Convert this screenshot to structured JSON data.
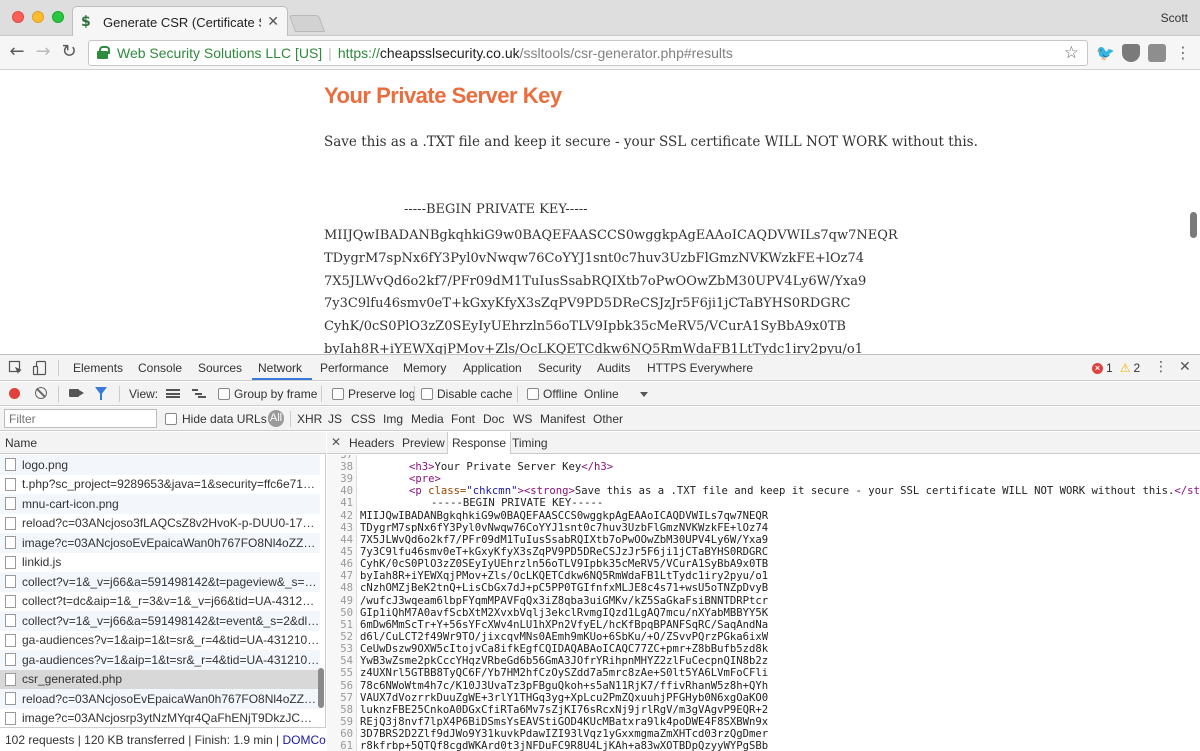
{
  "browser": {
    "tab_title": "Generate CSR (Certificate Sign",
    "profile": "Scott",
    "ev_name": "Web Security Solutions LLC [US]",
    "url_scheme": "https://",
    "url_host": "cheapsslsecurity.co.uk",
    "url_path": "/ssltools/csr-generator.php#results"
  },
  "page": {
    "heading": "Your Private Server Key",
    "intro": "Save this as a .TXT file and keep it secure - your SSL certificate WILL NOT WORK without this.",
    "key_begin": "-----BEGIN PRIVATE KEY-----",
    "key_lines": [
      "MIIJQwIBADANBgkqhkiG9w0BAQEFAASCCS0wggkpAgEAAoICAQDVWILs7qw7NEQR",
      "TDygrM7spNx6fY3Pyl0vNwqw76CoYYJ1snt0c7huv3UzbFlGmzNVKWzkFE+lOz74",
      "7X5JLWvQd6o2kf7/PFr09dM1TuIusSsabRQIXtb7oPwOOwZbM30UPV4Ly6W/Yxa9",
      "7y3C9lfu46smv0eT+kGxyKfyX3sZqPV9PD5DReCSJzJr5F6ji1jCTaBYHS0RDGRC",
      "CyhK/0cS0PlO3zZ0SEyIyUEhrzln56oTLV9Ipbk35cMeRV5/VCurA1SyBbA9x0TB",
      "byIah8R+iYEWXqjPMov+Zls/OcLKQETCdkw6NQ5RmWdaFB1LtTydc1iry2pyu/o1"
    ]
  },
  "devtools": {
    "tabs": [
      "Elements",
      "Console",
      "Sources",
      "Network",
      "Performance",
      "Memory",
      "Application",
      "Security",
      "Audits",
      "HTTPS Everywhere"
    ],
    "errors": "1",
    "warnings": "2",
    "net_toolbar": {
      "view_label": "View:",
      "group_by_frame": "Group by frame",
      "preserve_log": "Preserve log",
      "disable_cache": "Disable cache",
      "offline": "Offline",
      "throttle": "Online"
    },
    "filter": {
      "placeholder": "Filter",
      "hide_data_urls": "Hide data URLs",
      "all": "All",
      "types": [
        "XHR",
        "JS",
        "CSS",
        "Img",
        "Media",
        "Font",
        "Doc",
        "WS",
        "Manifest",
        "Other"
      ]
    },
    "names_header": "Name",
    "requests": [
      "logo.png",
      "t.php?sc_project=9289653&java=1&security=ffc6e71e&...",
      "mnu-cart-icon.png",
      "reload?c=03ANcjoso3fLAQCsZ8v2HvoK-p-DUU0-175uk...",
      "image?c=03ANcjosoEvEpaicaWan0h767FO8Nl4oZZmiO...",
      "linkid.js",
      "collect?v=1&_v=j66&a=591498142&t=pageview&_s=1&dl...",
      "collect?t=dc&aip=1&_r=3&v=1&_v=j66&tid=UA-43121050...",
      "collect?v=1&_v=j66&a=591498142&t=event&_s=2&dl=htt...",
      "ga-audiences?v=1&aip=1&t=sr&_r=4&tid=UA-43121050-...",
      "ga-audiences?v=1&aip=1&t=sr&_r=4&tid=UA-43121050-...",
      "csr_generated.php",
      "reload?c=03ANcjosoEvEpaicaWan0h767FO8Nl4oZZmiO...",
      "image?c=03ANcjosrp3ytNzMYqr4QaFhENjT9DkzJCwP40..."
    ],
    "status": {
      "text": "102 requests | 120 KB transferred | Finish: 1.9 min | ",
      "link": "DOMCon..."
    },
    "detail_tabs": [
      "Headers",
      "Preview",
      "Response",
      "Timing"
    ],
    "response": {
      "line_38_tag_open": "<h3>",
      "line_38_text": "Your Private Server Key",
      "line_38_tag_close": "</h3>",
      "line_39": "<pre>",
      "line_40_p": "<p ",
      "line_40_attr": "class=",
      "line_40_val": "\"chkcmn\"",
      "line_40_strong": "><strong>",
      "line_40_text": "Save this as a .TXT file and keep it secure - your SSL certificate WILL NOT WORK without this.",
      "line_40_end": "</stron",
      "line_41": "-----BEGIN PRIVATE KEY-----",
      "key_lines": [
        "MIIJQwIBADANBgkqhkiG9w0BAQEFAASCCS0wggkpAgEAAoICAQDVWILs7qw7NEQR",
        "TDygrM7spNx6fY3Pyl0vNwqw76CoYYJ1snt0c7huv3UzbFlGmzNVKWzkFE+lOz74",
        "7X5JLWvQd6o2kf7/PFr09dM1TuIusSsabRQIXtb7oPwOOwZbM30UPV4Ly6W/Yxa9",
        "7y3C9lfu46smv0eT+kGxyKfyX3sZqPV9PD5DReCSJzJr5F6ji1jCTaBYHS0RDGRC",
        "CyhK/0cS0PlO3zZ0SEyIyUEhrzln56oTLV9Ipbk35cMeRV5/VCurA1SyBbA9x0TB",
        "byIah8R+iYEWXqjPMov+Zls/OcLKQETCdkw6NQ5RmWdaFB1LtTydc1iry2pyu/o1",
        "cNzhOMZjBeK2tnQ+LisCbGx7dJ+pC5PP0TGIfnfxMLJE8c4s71+wsU5oTNZpDvyB",
        "/wufcJ3wqeam6lbpFYqmMPAVFqQx3iZ8qba3uiGMKv/kZ5SaGkaFsiBNNTDRPtcr",
        "GIp1iQhM7A0avfScbXtM2XvxbVqlj3ekclRvmgIQzd1LgAQ7mcu/nXYabMBBYY5K",
        "6mDw6MmScTr+Y+56sYFcXWv4nLU1hXPn2VfyEL/hcKfBpqBPANFSqRC/SaqAndNa",
        "d6l/CuLCT2f49Wr9TO/jixcqvMNs0AEmh9mKUo+6SbKu/+O/ZSvvPQrzPGka6ixW",
        "CeUwDszw9OXW5cItojvCa8ifkEgfCQIDAQABAoICAQC77ZC+pmr+Z8bBufb5zd8k",
        "YwB3wZsme2pkCccYHqzVRbeGd6b56GmA3JOfrYRihpnMHYZ2zlFuCecpnQIN8b2z",
        "z4UXNrl5GTBB8TyQC6F/Yb7HM2hfCzOySZdd7a5mrc8zAe+S0lt5YA6LVmFoCFli",
        "78c6NWoWtm4h7c/K10J3UvaTz3pFBguQkoh+s5aN11RjK7/ffivRhanW5z8h+QYh",
        "VAUX7dVozrrkDuuZgWE+3rlY1THGq3yg+XpLcu2PmZQxuuhjPFGHyb0N6xgOaKO0",
        "luknzFBE25CnkoA0DGxCfiRTa6Mv7sZjKI76sRcxNj9jrlRgV/m3gVAgvP9EQR+2",
        "REjQ3j8nvf7lpX4P6BiDSmsYsEAVStiGOD4KUcMBatxra9lk4poDWE4F8SXBWn9x",
        "3D7BRS2D2Zlf9dJWo9Y31kuvkPdawIZI93lVqz1yGxxmgmaZmXHTcd03rzQgDmer",
        "r8kfrbp+5QTQf8cgdWKArd0t3jNFDuFC9R8U4LjKAh+a83wXOTBDpQzyyWYPgSBb"
      ]
    }
  }
}
